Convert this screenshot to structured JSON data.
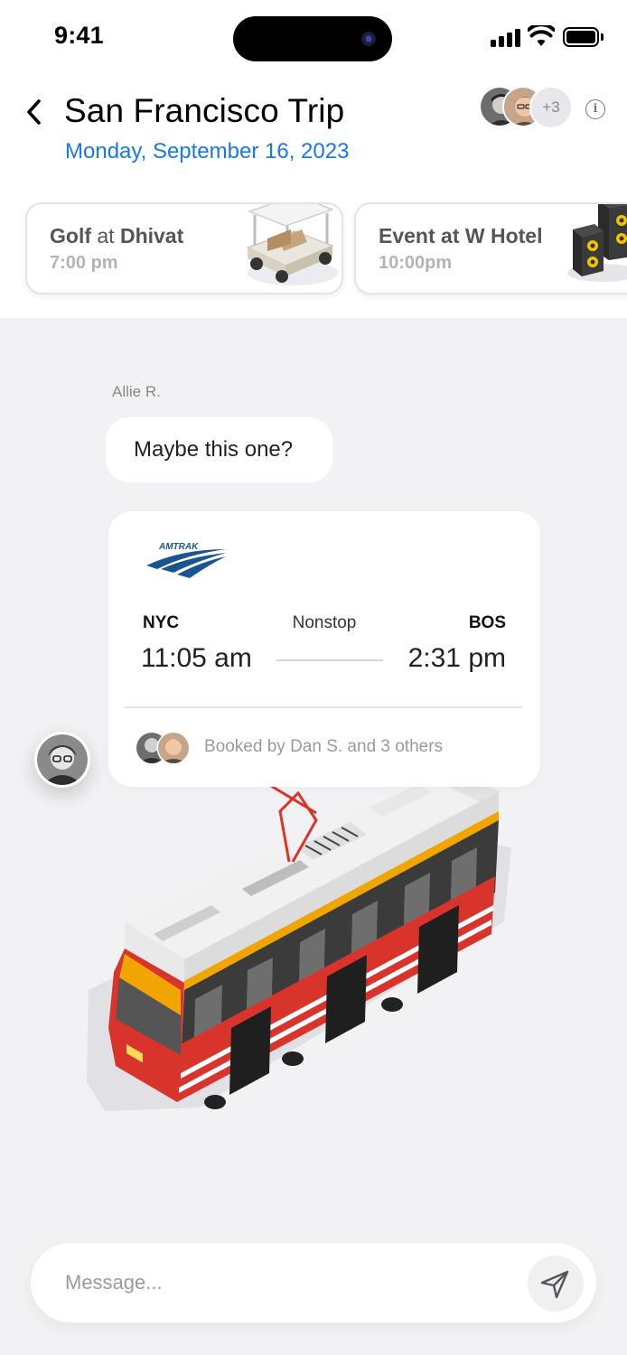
{
  "status_bar": {
    "time": "9:41",
    "signal_icon": "cellular-signal-icon",
    "wifi_icon": "wifi-icon",
    "battery_icon": "battery-icon"
  },
  "header": {
    "back_icon": "chevron-left-icon",
    "title": "San Francisco Trip",
    "date": "Monday, September 16, 2023",
    "participants_more": "+3",
    "info_icon": "info-icon",
    "accent_color": "#1877f2"
  },
  "events": [
    {
      "activity": "Golf",
      "connector": " at ",
      "place": "Dhivat",
      "time": "7:00 pm",
      "icon": "golf-cart-icon"
    },
    {
      "activity": "Event at W Hotel",
      "connector": "",
      "place": "",
      "time": "10:00pm",
      "icon": "speaker-icon"
    }
  ],
  "chat": {
    "sender": "Allie R.",
    "message": "Maybe this one?",
    "trip_card": {
      "carrier": "AMTRAK",
      "from_code": "NYC",
      "to_code": "BOS",
      "stops": "Nonstop",
      "depart": "11:05 am",
      "arrive": "2:31 pm",
      "booked_by": "Booked by Dan S. and 3 others"
    }
  },
  "composer": {
    "placeholder": "Message...",
    "send_icon": "send-icon"
  }
}
